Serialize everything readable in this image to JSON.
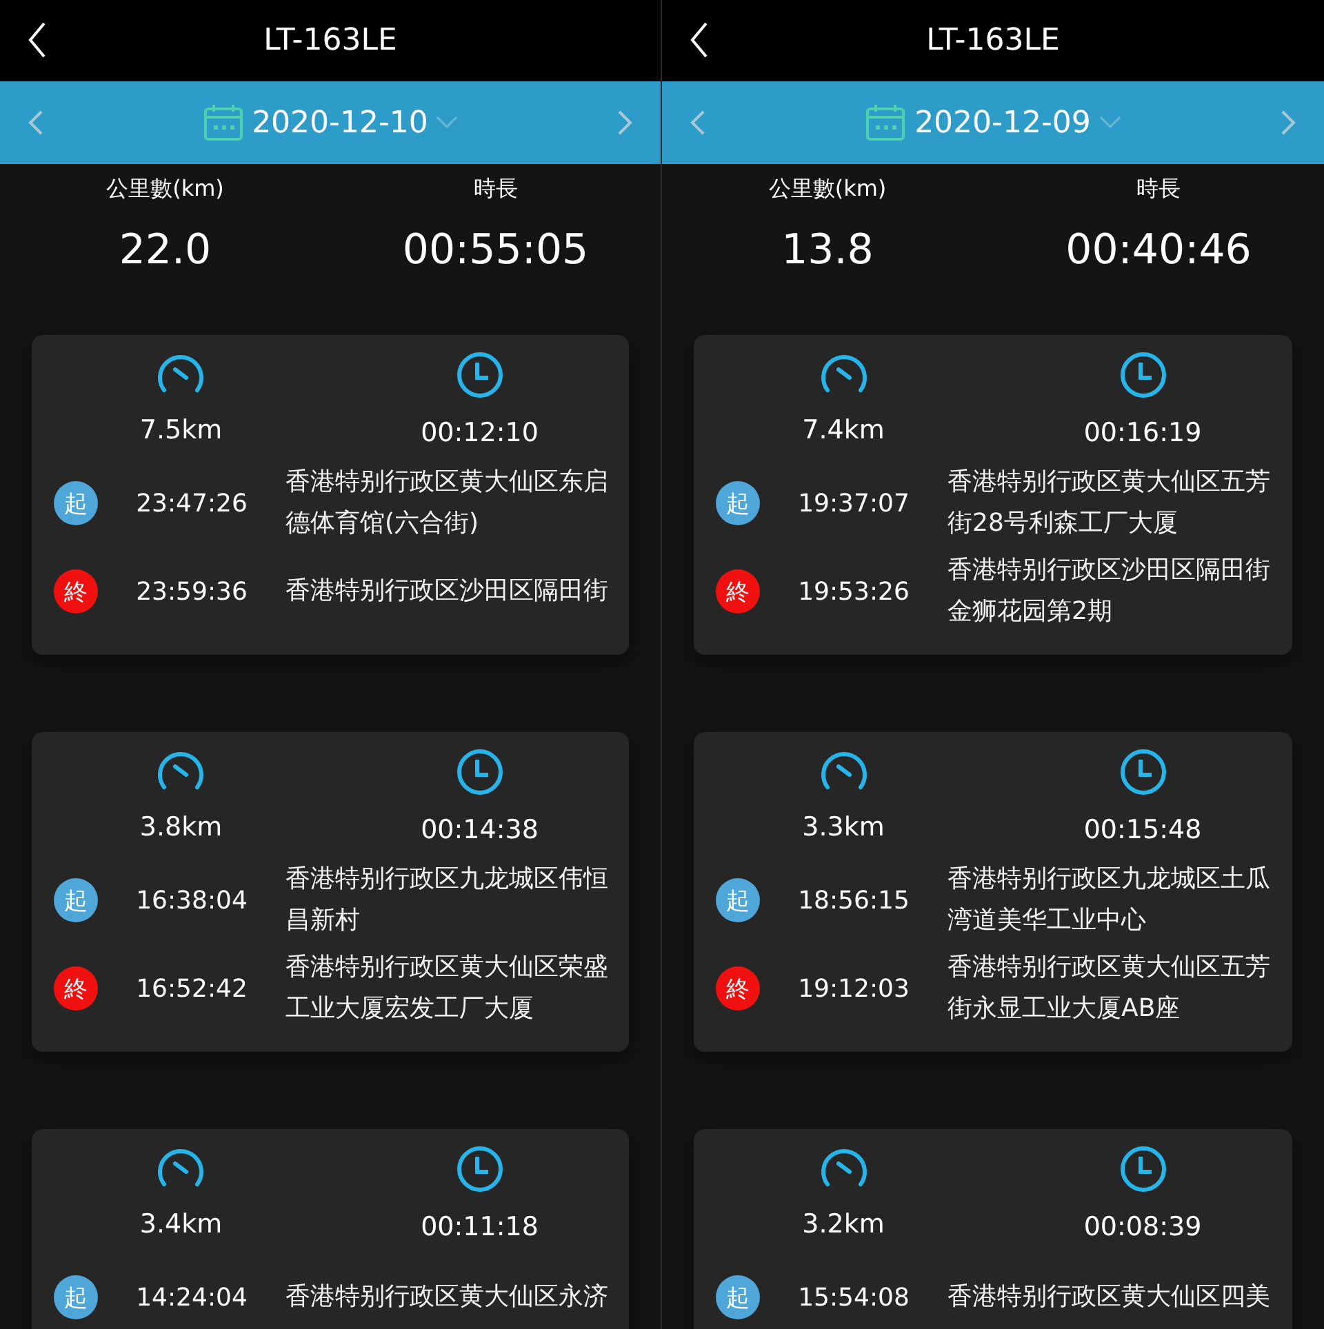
{
  "panels": [
    {
      "title": "LT-163LE",
      "date": "2020-12-10",
      "summary": {
        "distance_label": "公里數(km)",
        "distance": "22.0",
        "duration_label": "時長",
        "duration": "00:55:05"
      },
      "trips": [
        {
          "distance": "7.5km",
          "duration": "00:12:10",
          "stops": [
            {
              "kind": "start",
              "badge": "起",
              "time": "23:47:26",
              "address": "香港特别行政区黄大仙区东启德体育馆(六合街)"
            },
            {
              "kind": "end",
              "badge": "終",
              "time": "23:59:36",
              "address": "香港特别行政区沙田区隔田街"
            }
          ]
        },
        {
          "distance": "3.8km",
          "duration": "00:14:38",
          "stops": [
            {
              "kind": "start",
              "badge": "起",
              "time": "16:38:04",
              "address": "香港特别行政区九龙城区伟恒昌新村"
            },
            {
              "kind": "end",
              "badge": "終",
              "time": "16:52:42",
              "address": "香港特别行政区黄大仙区荣盛工业大厦宏发工厂大厦"
            }
          ]
        },
        {
          "distance": "3.4km",
          "duration": "00:11:18",
          "stops": [
            {
              "kind": "start",
              "badge": "起",
              "time": "14:24:04",
              "address": "香港特别行政区黄大仙区永济"
            }
          ]
        }
      ]
    },
    {
      "title": "LT-163LE",
      "date": "2020-12-09",
      "summary": {
        "distance_label": "公里數(km)",
        "distance": "13.8",
        "duration_label": "時長",
        "duration": "00:40:46"
      },
      "trips": [
        {
          "distance": "7.4km",
          "duration": "00:16:19",
          "stops": [
            {
              "kind": "start",
              "badge": "起",
              "time": "19:37:07",
              "address": "香港特别行政区黄大仙区五芳街28号利森工厂大厦"
            },
            {
              "kind": "end",
              "badge": "終",
              "time": "19:53:26",
              "address": "香港特别行政区沙田区隔田街金狮花园第2期"
            }
          ]
        },
        {
          "distance": "3.3km",
          "duration": "00:15:48",
          "stops": [
            {
              "kind": "start",
              "badge": "起",
              "time": "18:56:15",
              "address": "香港特别行政区九龙城区土瓜湾道美华工业中心"
            },
            {
              "kind": "end",
              "badge": "終",
              "time": "19:12:03",
              "address": "香港特别行政区黄大仙区五芳街永显工业大厦AB座"
            }
          ]
        },
        {
          "distance": "3.2km",
          "duration": "00:08:39",
          "stops": [
            {
              "kind": "start",
              "badge": "起",
              "time": "15:54:08",
              "address": "香港特别行政区黄大仙区四美"
            }
          ]
        }
      ]
    }
  ]
}
